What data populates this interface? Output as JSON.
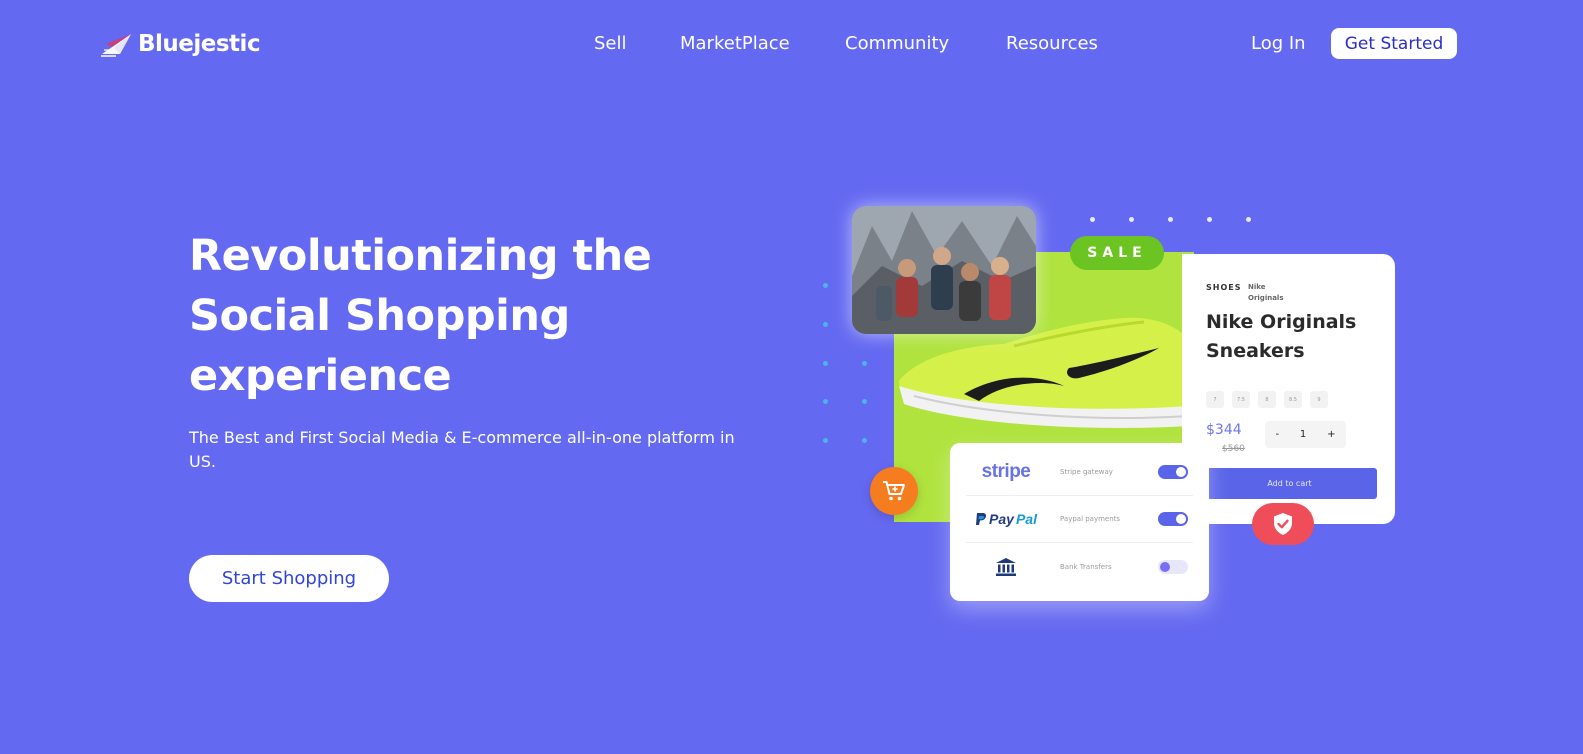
{
  "brand": {
    "name": "Bluejestic"
  },
  "nav": {
    "links": [
      "Sell",
      "MarketPlace",
      "Community",
      "Resources"
    ],
    "login": "Log In",
    "cta": "Get Started"
  },
  "hero": {
    "title": "Revolutionizing the Social Shopping experience",
    "subtitle": "The Best and First Social Media & E-commerce all-in-one platform in US.",
    "button": "Start Shopping"
  },
  "illustration": {
    "sale_badge": "SALE",
    "product": {
      "category": "SHOES",
      "brand": "Nike Originals",
      "name": "Nike Originals Sneakers",
      "sizes": [
        "7",
        "7.5",
        "8",
        "8.5",
        "9"
      ],
      "price": "$344",
      "old_price": "$560",
      "qty_minus": "-",
      "qty": "1",
      "qty_plus": "+",
      "add_to_cart": "Add to cart"
    },
    "payments": [
      {
        "logo": "stripe",
        "label": "Stripe gateway",
        "enabled": true
      },
      {
        "logo_parts": [
          "Pay",
          "Pal"
        ],
        "label": "Paypal payments",
        "enabled": true
      },
      {
        "logo": "bank-icon",
        "label": "Bank Transfers",
        "enabled": false
      }
    ],
    "icons": [
      "cart-icon",
      "shield-check-icon",
      "bank-icon",
      "paypal-p-icon"
    ]
  },
  "colors": {
    "background": "#6469F1",
    "accent": "#5964E8",
    "sale_green": "#6CC422",
    "panel_green": "#B0E33E",
    "cart_orange": "#F57C1F",
    "shield_red": "#F04D5A"
  }
}
